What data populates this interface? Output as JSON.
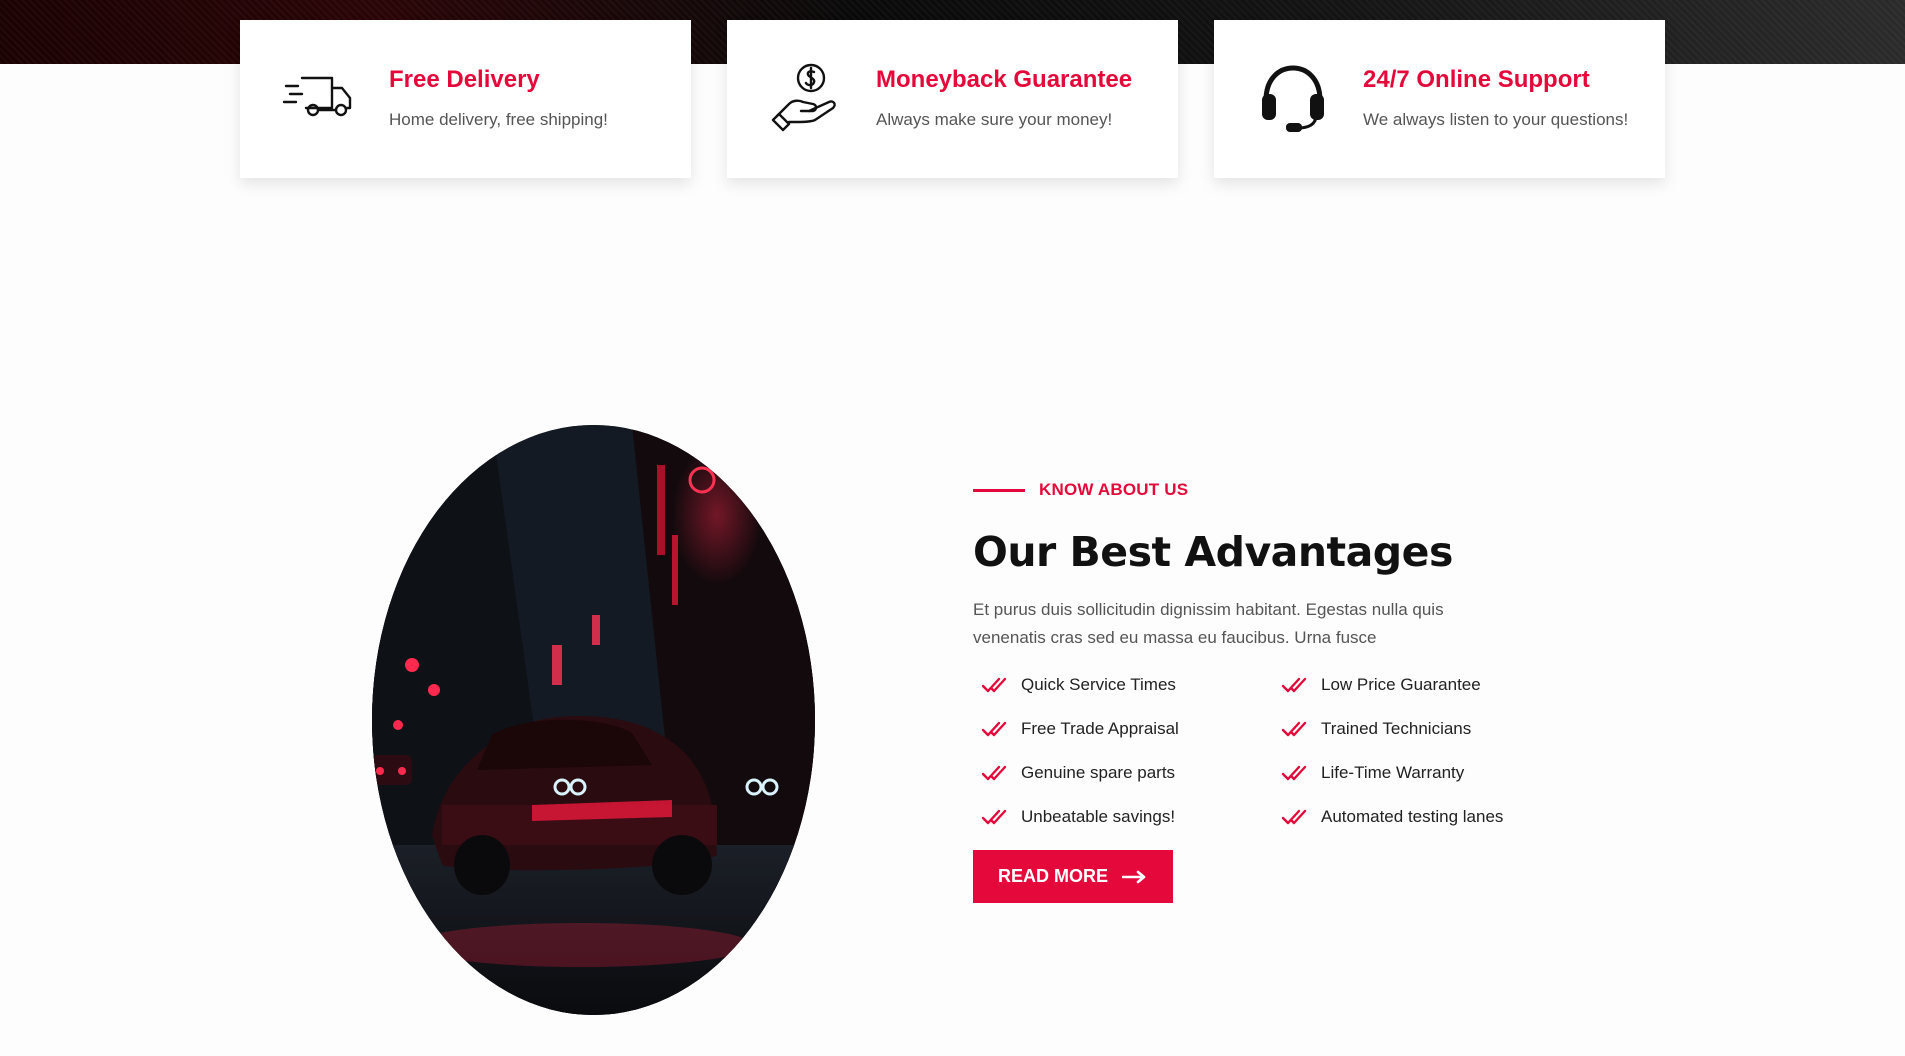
{
  "features": [
    {
      "title": "Free Delivery",
      "desc": "Home delivery, free shipping!",
      "icon": "delivery-truck-icon"
    },
    {
      "title": "Moneyback Guarantee",
      "desc": "Always make sure your money!",
      "icon": "money-hand-icon"
    },
    {
      "title": "24/7 Online Support",
      "desc": "We always listen to your questions!",
      "icon": "headset-icon"
    }
  ],
  "about": {
    "eyebrow": "KNOW ABOUT US",
    "heading": "Our Best Advantages",
    "lead": "Et purus duis sollicitudin dignissim habitant. Egestas nulla quis venenatis cras sed eu massa eu faucibus. Urna fusce",
    "checklist": [
      "Quick Service Times",
      "Low Price Guarantee",
      "Free Trade Appraisal",
      "Trained Technicians",
      "Genuine spare parts",
      "Life-Time Warranty",
      "Unbeatable savings!",
      "Automated testing lanes"
    ],
    "button": "READ MORE",
    "image_icon": "car-photo"
  },
  "colors": {
    "accent": "#e4093a",
    "text": "#111111",
    "muted": "#555555",
    "background": "#fdfdfd"
  }
}
